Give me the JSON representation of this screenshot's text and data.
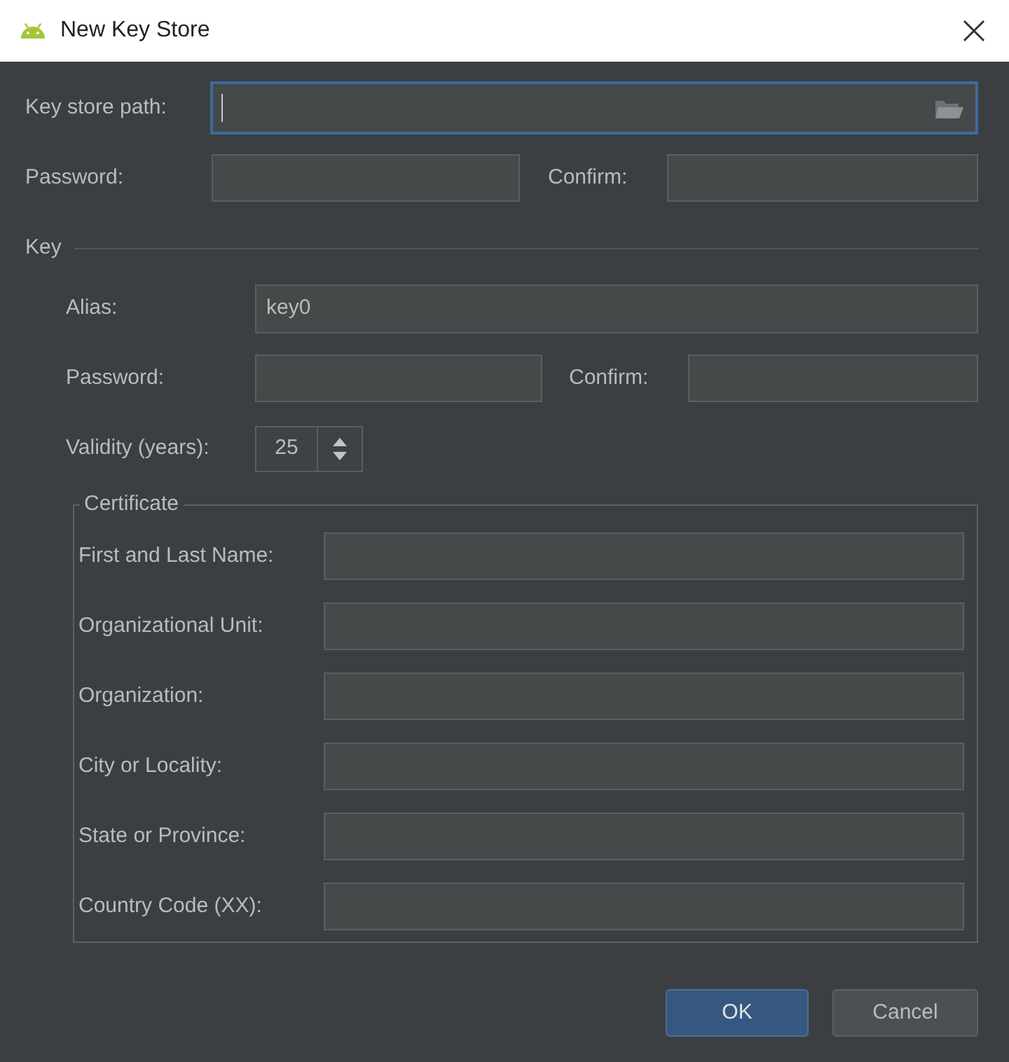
{
  "window": {
    "title": "New Key Store"
  },
  "keystore": {
    "path_field": {
      "label": "Key store path:",
      "focused": true
    },
    "password": {
      "label": "Password:",
      "focused": false
    },
    "confirm": {
      "label": "Confirm:",
      "focused": false
    }
  },
  "key": {
    "section_title": "Key",
    "alias": {
      "label": "Alias:",
      "value": "key0",
      "focused": false
    },
    "password": {
      "label": "Password:",
      "focused": false
    },
    "confirm": {
      "label": "Confirm:",
      "focused": false
    },
    "validity": {
      "label": "Validity (years):",
      "value": "25"
    },
    "certificate": {
      "title": "Certificate",
      "fields": [
        {
          "label": "First and Last Name:",
          "focused": false
        },
        {
          "label": "Organizational Unit:",
          "focused": false
        },
        {
          "label": "Organization:",
          "focused": false
        },
        {
          "label": "City or Locality:",
          "focused": false
        },
        {
          "label": "State or Province:",
          "focused": false
        },
        {
          "label": "Country Code (XX):",
          "focused": false
        }
      ]
    }
  },
  "buttons": [
    {
      "label": "OK",
      "kind": "primary"
    },
    {
      "label": "Cancel",
      "kind": "secondary"
    }
  ]
}
